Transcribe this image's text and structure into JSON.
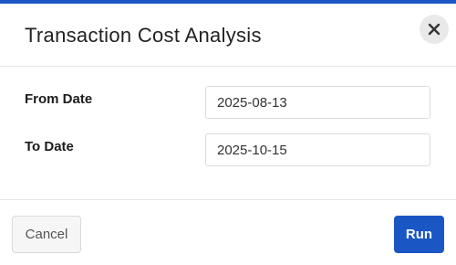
{
  "dialog": {
    "title": "Transaction Cost Analysis",
    "close_icon": "close-icon"
  },
  "form": {
    "from_date": {
      "label": "From Date",
      "value": "2025-08-13"
    },
    "to_date": {
      "label": "To Date",
      "value": "2025-10-15"
    }
  },
  "footer": {
    "cancel_label": "Cancel",
    "run_label": "Run"
  },
  "colors": {
    "accent": "#1a56c4",
    "close_button_bg": "#e9e9e9",
    "cancel_button_bg": "#f6f6f6"
  }
}
